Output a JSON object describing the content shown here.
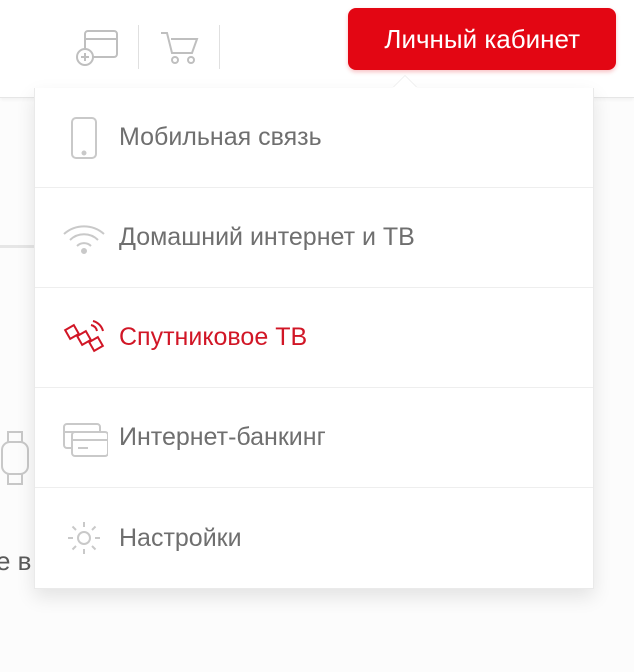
{
  "colors": {
    "accent": "#e30613",
    "text": "#6f6f6f",
    "icon": "#c9c9c9"
  },
  "topbar": {
    "wallet_icon": "wallet-add",
    "cart_icon": "cart",
    "account_button_label": "Личный кабинет"
  },
  "menu": {
    "items": [
      {
        "icon": "phone",
        "label": "Мобильная связь",
        "active": false
      },
      {
        "icon": "wifi",
        "label": "Домашний интернет и ТВ",
        "active": false
      },
      {
        "icon": "satellite",
        "label": "Спутниковое ТВ",
        "active": true
      },
      {
        "icon": "card",
        "label": "Интернет-банкинг",
        "active": false
      },
      {
        "icon": "gear",
        "label": "Настройки",
        "active": false
      }
    ]
  },
  "background_peek": {
    "text_fragment": "е в"
  }
}
